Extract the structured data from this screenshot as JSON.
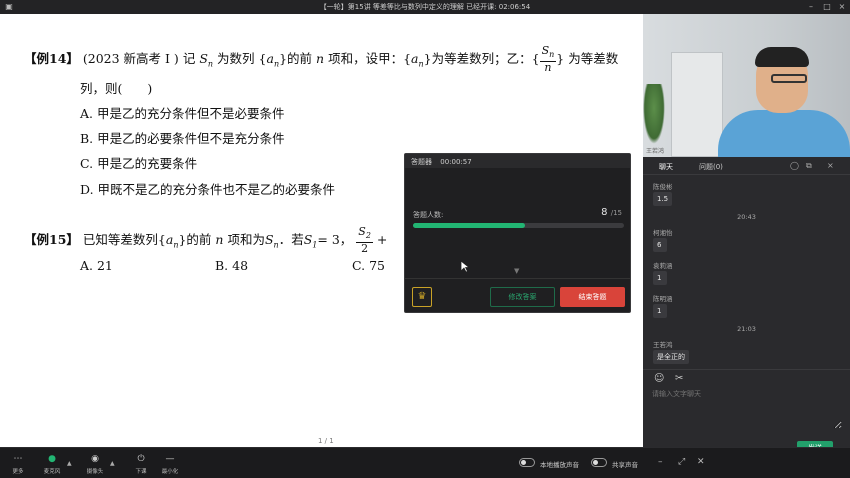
{
  "titlebar": {
    "title": "【一轮】第15讲 等差等比与数列中定义的理解   已经开课: 02:06:54"
  },
  "slide": {
    "q14": {
      "tag": "【例14】",
      "source": "(2023 新高考 I )",
      "text_a": "记",
      "text_b": "为数列",
      "text_c": "的前",
      "text_d": "项和，设甲：",
      "text_e": "为等差数列；乙：{",
      "text_f": "} 为等差数",
      "line2": "列，则(　　)",
      "options": [
        "A.  甲是乙的充分条件但不是必要条件",
        "B.  甲是乙的必要条件但不是充分条件",
        "C.  甲是乙的充要条件",
        "D.  甲既不是乙的充分条件也不是乙的必要条件"
      ]
    },
    "q15": {
      "tag": "【例15】",
      "text_a": "已知等差数列",
      "text_b": "的前",
      "text_c": "项和为",
      "text_d": "．若",
      "text_e": "= 3，",
      "options": [
        "A.  21",
        "B.  48",
        "C.  75"
      ]
    },
    "page": "1 / 1"
  },
  "quiz": {
    "title": "答题器",
    "timer": "00:00:57",
    "count_label": "答题人数:",
    "count": "8",
    "total": "/15",
    "progress": 0.53,
    "modify_label": "修改答案",
    "end_label": "结束答题"
  },
  "cam": {
    "name": "王若鸿"
  },
  "chat": {
    "tab_chat": "聊天",
    "tab_questions": "问题(0)",
    "messages": [
      {
        "sender": "陈俊彬",
        "text": "1.5"
      },
      {
        "time": "20:43"
      },
      {
        "sender": "柯湘怡",
        "text": "6"
      },
      {
        "sender": "袁莉涵",
        "text": "1"
      },
      {
        "sender": "陈明涵",
        "text": "1"
      },
      {
        "time": "21:03"
      },
      {
        "sender": "王若鸿",
        "text": "是全正的"
      }
    ],
    "input_placeholder": "请输入文字聊天",
    "send_label": "发送"
  },
  "toolbar": {
    "more": "更多",
    "mic": "麦克风",
    "camera": "摄像头",
    "leave": "下课",
    "minimize": "最小化",
    "local_audio": "本地播放声音",
    "share_audio": "共享声音"
  }
}
